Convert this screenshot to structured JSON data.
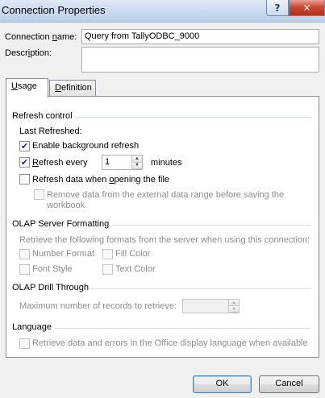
{
  "window": {
    "title": "Connection Properties",
    "help_glyph": "?",
    "close_glyph": "✕"
  },
  "connection": {
    "name_label_pre": "Connection ",
    "name_label_key": "n",
    "name_label_post": "ame:",
    "name_value": "Query from TallyODBC_9000",
    "description_label_pre": "Descr",
    "description_label_key": "i",
    "description_label_post": "ption:",
    "description_value": ""
  },
  "tabs": [
    {
      "key": "U",
      "rest": "sage",
      "active": true
    },
    {
      "pre": "",
      "key": "D",
      "rest": "efinition",
      "active": false
    }
  ],
  "refresh": {
    "group_title": "Refresh control",
    "last_refreshed_label": "Last Refreshed:",
    "enable_background": {
      "pre": "Enable back",
      "key": "g",
      "post": "round refresh",
      "checked": true
    },
    "refresh_every": {
      "pre": "",
      "key": "R",
      "post": "efresh every",
      "checked": true,
      "value": "1",
      "unit": "minutes"
    },
    "refresh_on_open": {
      "pre": "Refresh data when ",
      "key": "o",
      "post": "pening the file",
      "checked": false
    },
    "remove_data": {
      "line1": "Remove data from the external data range before saving the",
      "line2": "workbook",
      "checked": false,
      "disabled": true
    }
  },
  "olap_formatting": {
    "group_title": "OLAP Server Formatting",
    "description": "Retrieve the following formats from the server when using this connection:",
    "number_format": "Number Format",
    "fill_color": "Fill Color",
    "font_style": "Font Style",
    "text_color": "Text Color"
  },
  "olap_drill": {
    "group_title": "OLAP Drill Through",
    "max_records_label": "Maximum number of records to retrieve:",
    "max_records_value": ""
  },
  "language": {
    "group_title": "Language",
    "retrieve_label": "Retrieve data and errors in the Office display language when available"
  },
  "buttons": {
    "ok": "OK",
    "cancel": "Cancel"
  },
  "icons": {
    "check": "✔",
    "up_arrow": "▲",
    "down_arrow": "▼"
  }
}
